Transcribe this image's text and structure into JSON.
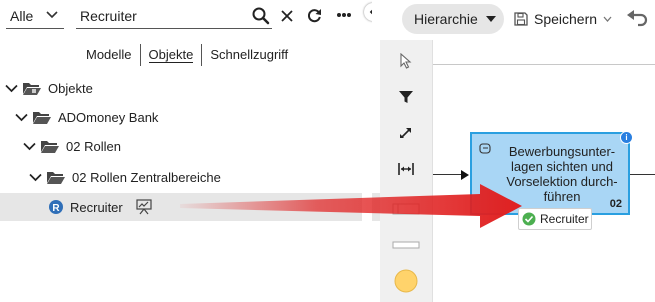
{
  "left_panel": {
    "filter": {
      "value": "Alle"
    },
    "search": {
      "value": "Recruiter",
      "placeholder": ""
    },
    "tabs": [
      {
        "label": "Modelle"
      },
      {
        "label": "Objekte"
      },
      {
        "label": "Schnellzugriff"
      }
    ],
    "tree": [
      {
        "label": "Objekte"
      },
      {
        "label": "ADOmoney Bank"
      },
      {
        "label": "02 Rollen"
      },
      {
        "label": "02 Rollen Zentralbereiche"
      },
      {
        "label": "Recruiter"
      }
    ]
  },
  "toolbar": {
    "hierarchy_label": "Hierarchie",
    "save_label": "Speichern"
  },
  "canvas": {
    "activity": {
      "title": "Bewerbungsunter-lagen sichten und Vorselektion durch-führen",
      "number": "02",
      "info": "i"
    },
    "role_badge": {
      "label": "Recruiter"
    }
  },
  "colors": {
    "activity_fill": "#a9d6f5",
    "activity_border": "#2a9fe0",
    "drag_arrow": "#e02020",
    "palette_bg": "#f0f0f0",
    "selected_row": "#e6e6e6",
    "role_check": "#4caf50",
    "palette_circle": "#ffd36b"
  }
}
